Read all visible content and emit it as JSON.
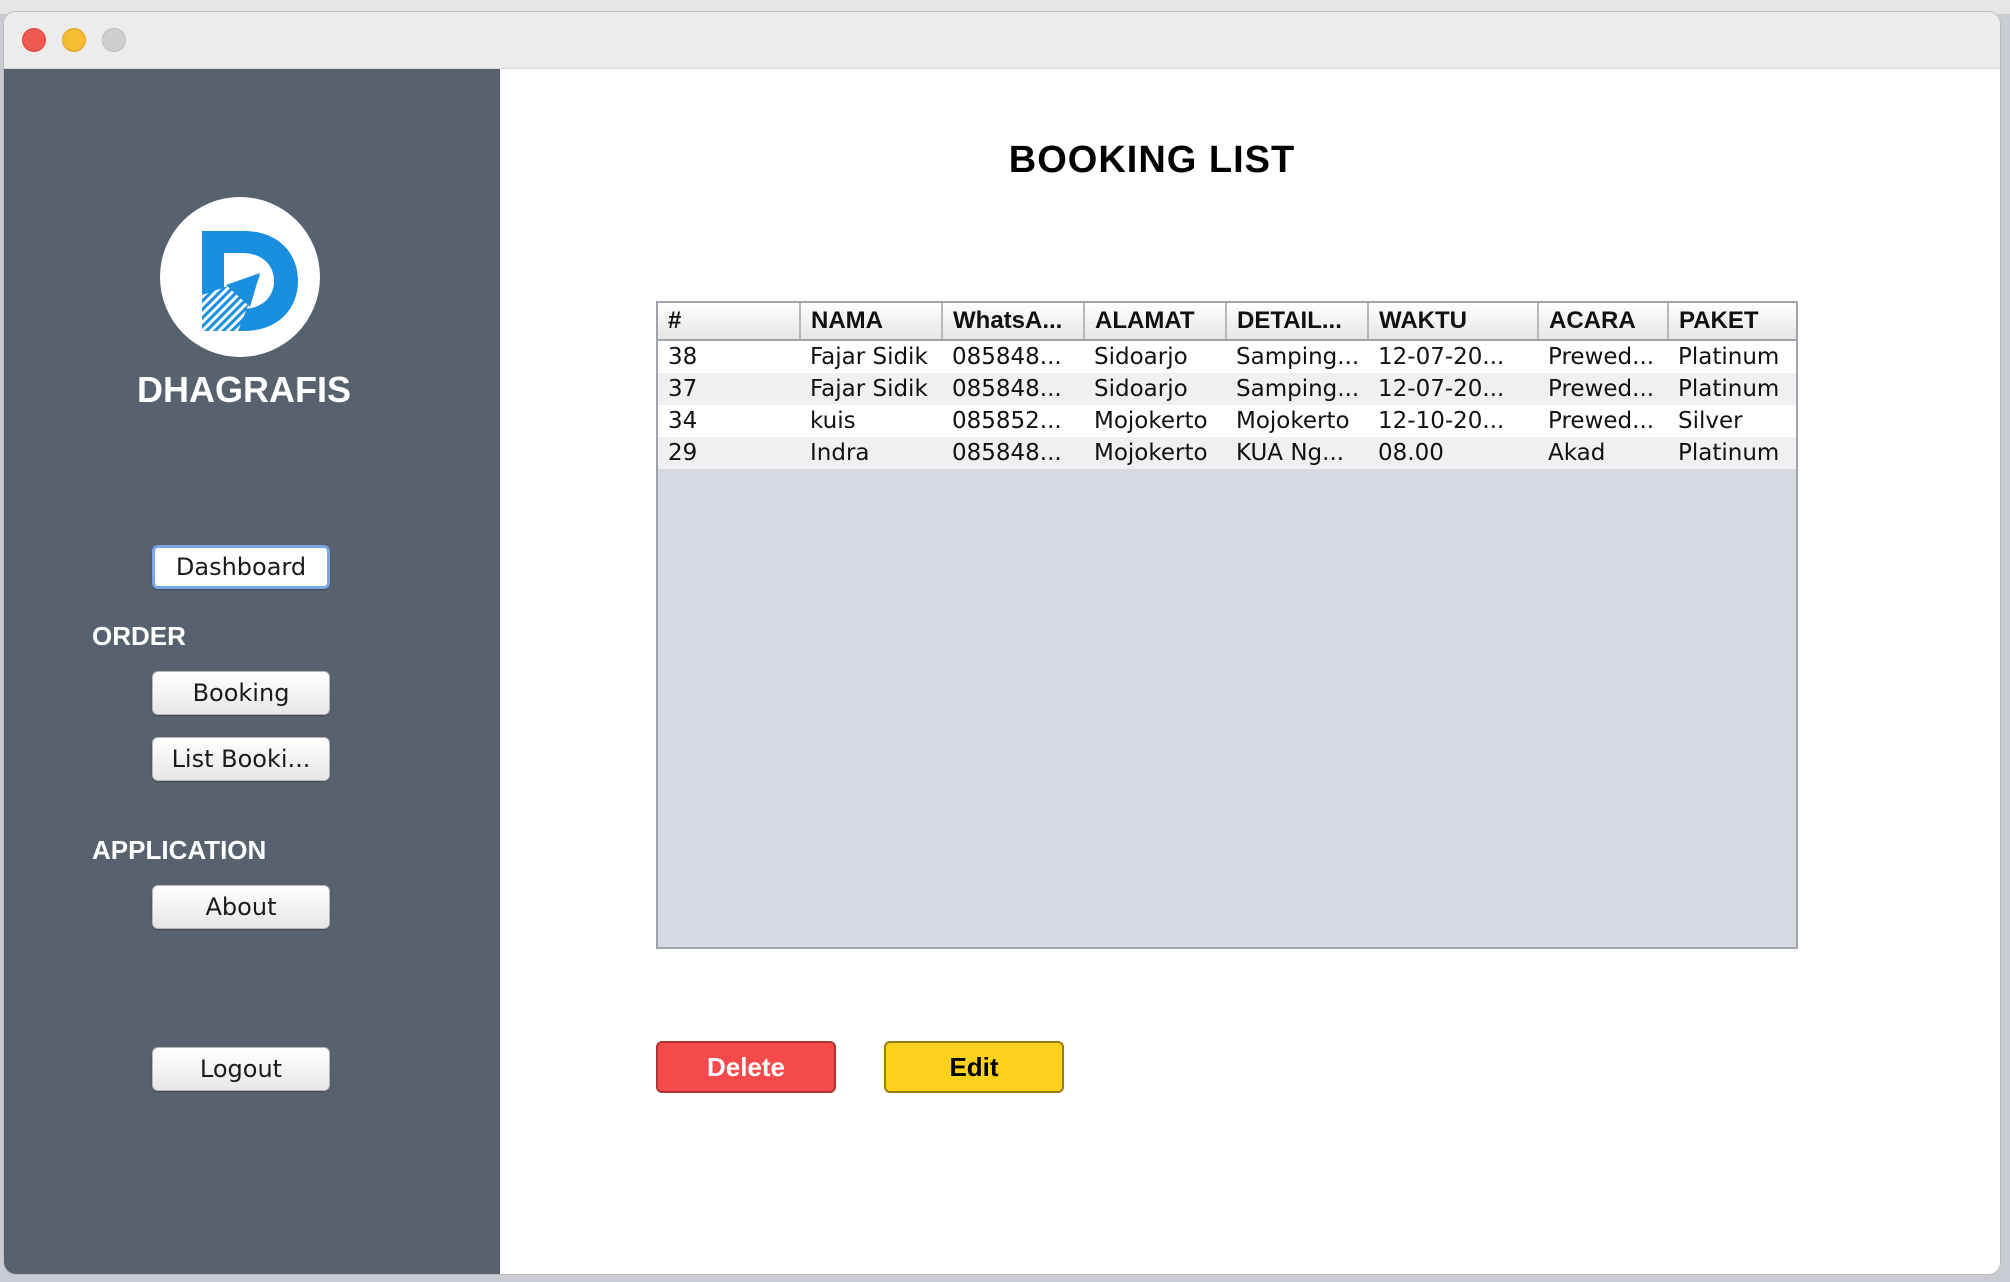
{
  "window": {
    "controls": [
      "close",
      "minimize",
      "zoom"
    ]
  },
  "sidebar": {
    "brand": "DHAGRAFIS",
    "logo_letter": "D",
    "dashboard_label": "Dashboard",
    "order_heading": "ORDER",
    "booking_label": "Booking",
    "list_booking_label": "List Booki...",
    "application_heading": "APPLICATION",
    "about_label": "About",
    "logout_label": "Logout",
    "colors": {
      "background": "#58616e",
      "logo_blue": "#1a8fe0"
    }
  },
  "main": {
    "title": "BOOKING LIST",
    "table": {
      "headers": [
        "#",
        "NAMA",
        "WhatsA...",
        "ALAMAT",
        "DETAIL...",
        "WAKTU",
        "ACARA",
        "PAKET"
      ],
      "rows": [
        [
          "38",
          "Fajar Sidik",
          "085848...",
          "Sidoarjo",
          "Samping...",
          "12-07-20...",
          "Prewed...",
          "Platinum"
        ],
        [
          "37",
          "Fajar Sidik",
          "085848...",
          "Sidoarjo",
          "Samping...",
          "12-07-20...",
          "Prewed...",
          "Platinum"
        ],
        [
          "34",
          "kuis",
          "085852...",
          "Mojokerto",
          "Mojokerto",
          "12-10-20...",
          "Prewed...",
          "Silver"
        ],
        [
          "29",
          "Indra",
          "085848...",
          "Mojokerto",
          "KUA Ng...",
          "08.00",
          "Akad",
          "Platinum"
        ]
      ]
    },
    "delete_label": "Delete",
    "edit_label": "Edit",
    "colors": {
      "delete": "#f54a4c",
      "edit": "#fed21c"
    }
  }
}
